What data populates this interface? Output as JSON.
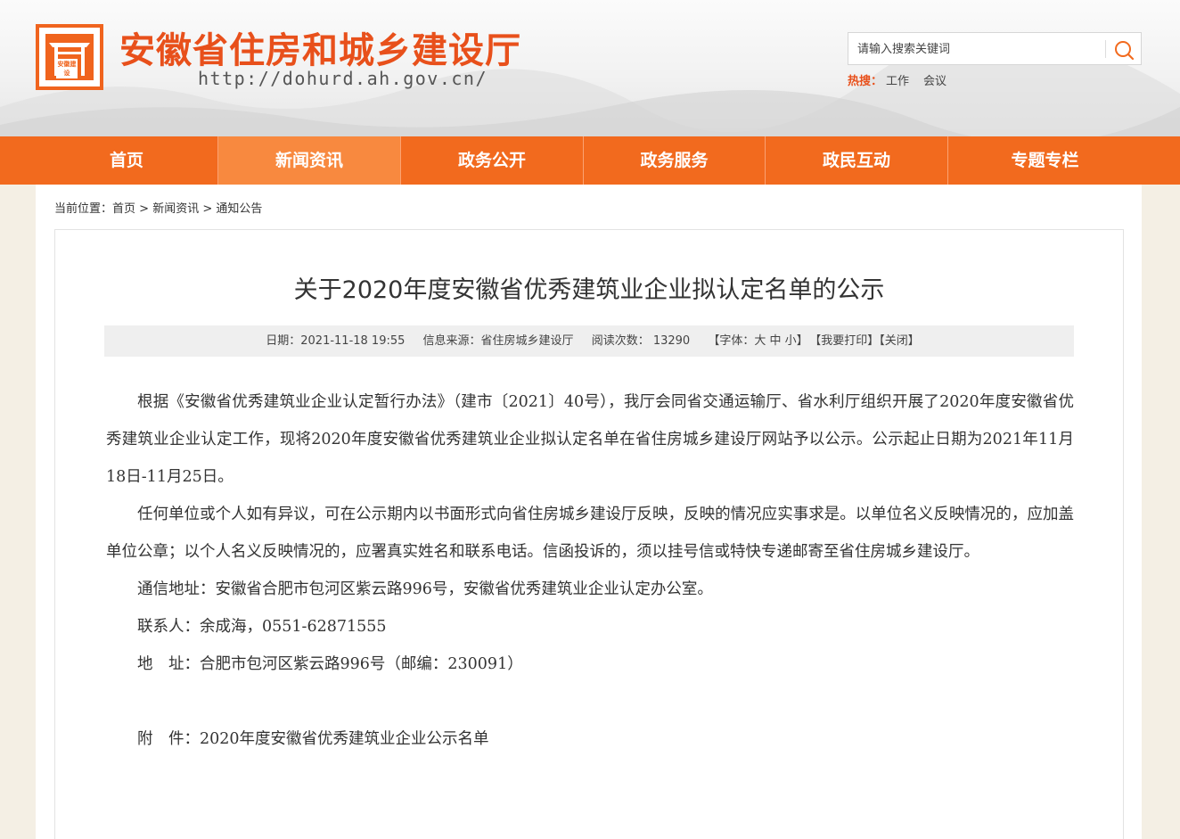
{
  "header": {
    "logo_seal": "安徽建设",
    "site_title": "安徽省住房和城乡建设厅",
    "site_url": "http://dohurd.ah.gov.cn/",
    "search_placeholder": "请输入搜索关键词",
    "hot_label": "热搜：",
    "hot_links": [
      "工作",
      "会议"
    ]
  },
  "nav": {
    "items": [
      "首页",
      "新闻资讯",
      "政务公开",
      "政务服务",
      "政民互动",
      "专题专栏"
    ],
    "active_index": 1
  },
  "breadcrumb": {
    "prefix": "当前位置：",
    "items": [
      "首页",
      "新闻资讯",
      "通知公告"
    ],
    "separator": " > "
  },
  "article": {
    "title": "关于2020年度安徽省优秀建筑业企业拟认定名单的公示",
    "meta": {
      "date": "日期：2021-11-18 19:55",
      "source": "信息来源：省住房城乡建设厅",
      "views": "阅读次数： 13290",
      "font_prefix": "【字体：",
      "font_large": "大",
      "font_medium": "中",
      "font_small": "小",
      "font_suffix": "】",
      "print": "【我要打印】",
      "close": "【关闭】"
    },
    "paragraphs": [
      "根据《安徽省优秀建筑业企业认定暂行办法》（建市〔2021〕40号），我厅会同省交通运输厅、省水利厅组织开展了2020年度安徽省优秀建筑业企业认定工作，现将2020年度安徽省优秀建筑业企业拟认定名单在省住房城乡建设厅网站予以公示。公示起止日期为2021年11月18日-11月25日。",
      "任何单位或个人如有异议，可在公示期内以书面形式向省住房城乡建设厅反映，反映的情况应实事求是。以单位名义反映情况的，应加盖单位公章；以个人名义反映情况的，应署真实姓名和联系电话。信函投诉的，须以挂号信或特快专递邮寄至省住房城乡建设厅。",
      "通信地址：安徽省合肥市包河区紫云路996号，安徽省优秀建筑业企业认定办公室。",
      "联系人：余成海，0551-62871555",
      "地　址：合肥市包河区紫云路996号（邮编：230091）"
    ],
    "attachment": "附　件：2020年度安徽省优秀建筑业企业公示名单"
  },
  "colors": {
    "brand_orange": "#f26a1e",
    "title_orange": "#e8501b"
  }
}
